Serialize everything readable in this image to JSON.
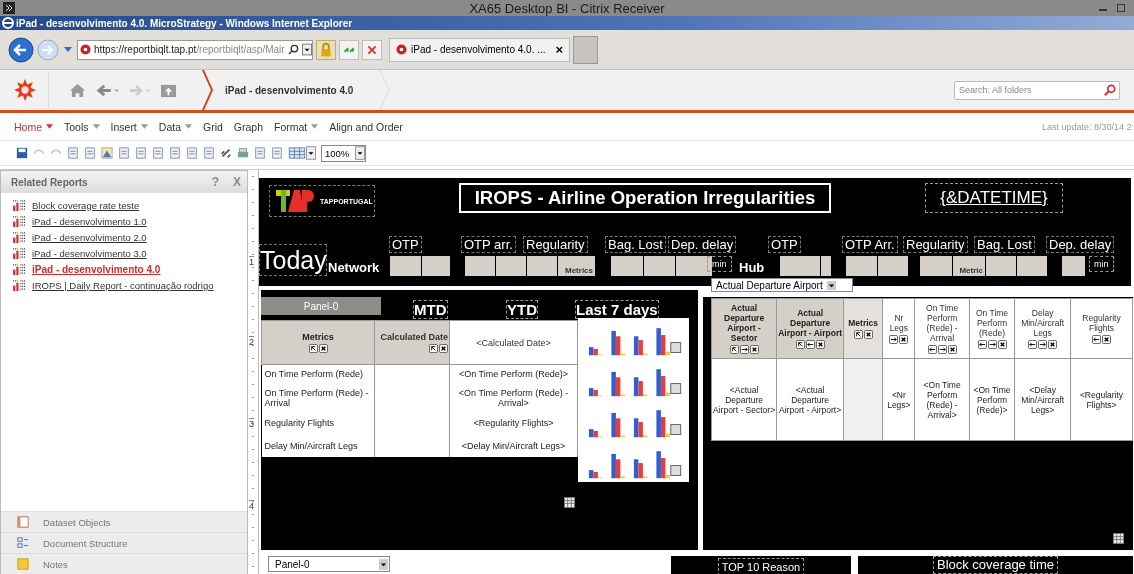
{
  "citrix": {
    "title": "XA65 Desktop BI - Citrix Receiver"
  },
  "window": {
    "title": "iPad - desenvolvimento 4.0. MicroStrategy - Windows Internet Explorer"
  },
  "address": {
    "host": "https://reportbiqlt.tap.pt",
    "path": "/reportbiqlt/asp/Mair"
  },
  "browser_tab": {
    "label": "iPad - desenvolvimento 4.0. ...",
    "close": "×"
  },
  "app_header": {
    "breadcrumb": "iPad - desenvolvimento 4.0",
    "search": {
      "placeholder": "Search: All folders"
    }
  },
  "menu": [
    {
      "label": "Home",
      "dropdown": true,
      "selected": true
    },
    {
      "label": "Tools",
      "dropdown": true,
      "selected": false
    },
    {
      "label": "Insert",
      "dropdown": true,
      "selected": false
    },
    {
      "label": "Data",
      "dropdown": true,
      "selected": false
    },
    {
      "label": "Grid",
      "dropdown": false,
      "selected": false
    },
    {
      "label": "Graph",
      "dropdown": false,
      "selected": false
    },
    {
      "label": "Format",
      "dropdown": true,
      "selected": false
    },
    {
      "label": "Align and Order",
      "dropdown": false,
      "selected": false
    }
  ],
  "last_update": "Last update: 8/30/14 2:",
  "zoom": {
    "value": "100%"
  },
  "related_reports": {
    "title": "Related Reports",
    "help": "?",
    "close": "X",
    "items": [
      {
        "label": "Block coverage rate teste",
        "selected": false
      },
      {
        "label": "iPad - desenvolvimento 1.0",
        "selected": false
      },
      {
        "label": "iPad - desenvolvimento 2.0",
        "selected": false
      },
      {
        "label": "iPad - desenvolvimento 3.0",
        "selected": false
      },
      {
        "label": "iPad - desenvolvimento 4.0",
        "selected": true
      },
      {
        "label": "IROPS | Daily Report - continuação rodrigo",
        "selected": false
      }
    ]
  },
  "bottom_panels": [
    {
      "kind": "dataset",
      "label": "Dataset Objects"
    },
    {
      "kind": "structure",
      "label": "Document Structure"
    },
    {
      "kind": "notes",
      "label": "Notes"
    }
  ],
  "ruler": [
    "1",
    "2",
    "3",
    "4"
  ],
  "report": {
    "logo_text": "TAPPORTUGAL",
    "title": "IROPS - Airline Operation Irregularities",
    "datetime": "{&DATETIME}",
    "today": "Today",
    "network": {
      "label": "Network",
      "metrics": [
        "OTP",
        "OTP arr.",
        "Regularity",
        "Bag. Lost",
        "Dep. delay"
      ],
      "tag": "Metrics",
      "unit": "min"
    },
    "hub": {
      "label": "Hub",
      "metrics": [
        "OTP",
        "OTP Arr.",
        "Regularity",
        "Bag. Lost",
        "Dep. delay"
      ],
      "tag": "Metric",
      "unit": "min"
    },
    "airport_selector": "Actual Departure Airport",
    "left_panel": {
      "panel_tab": "Panel-0",
      "headings": [
        "MTD",
        "YTD",
        "Last 7 days"
      ],
      "columns": [
        {
          "kind": "attribute",
          "heading": "Metrics"
        },
        {
          "kind": "metric",
          "heading": "Calculated Date"
        },
        {
          "kind": "value",
          "heading": "<Calculated Date>"
        }
      ],
      "rows": [
        {
          "label": "On Time Perform (Rede)",
          "value": "<On Time Perform (Rede)>"
        },
        {
          "label": "On Time Perform (Rede) - Arrival",
          "value": "<On Time Perform (Rede) - Arrival>"
        },
        {
          "label": "Regularity Flights",
          "value": "<Regularity Flights>"
        },
        {
          "label": "Delay Min/Aircraft Legs",
          "value": "<Delay Min/Aircraft Legs>"
        }
      ]
    },
    "right_grid": {
      "columns": [
        {
          "kind": "attribute",
          "heading": "Actual Departure Airport - Sector",
          "value": "<Actual Departure Airport - Sector>"
        },
        {
          "kind": "attribute",
          "heading": "Actual Departure Airport - Airport",
          "value": "<Actual Departure Airport - Airport>"
        },
        {
          "kind": "metrics",
          "heading": "Metrics"
        },
        {
          "kind": "metric",
          "heading": "Nr Legs",
          "value": "<Nr Legs>"
        },
        {
          "kind": "metric",
          "heading": "On Time Perform (Rede) - Arrival",
          "value": "<On Time Perform (Rede) - Arrival>"
        },
        {
          "kind": "metric",
          "heading": "On Time Perform (Rede)",
          "value": "<On Time Perform (Rede)>"
        },
        {
          "kind": "metric",
          "heading": "Delay Min/Aircraft Legs",
          "value": "<Delay Min/Aircraft Legs>"
        },
        {
          "kind": "metric",
          "heading": "Regularity Flights",
          "value": "<Regularity Flights>"
        }
      ]
    },
    "panel_selector": "Panel-0",
    "bottom_blocks": [
      "TOP 10 Reason",
      "Block coverage time"
    ]
  }
}
